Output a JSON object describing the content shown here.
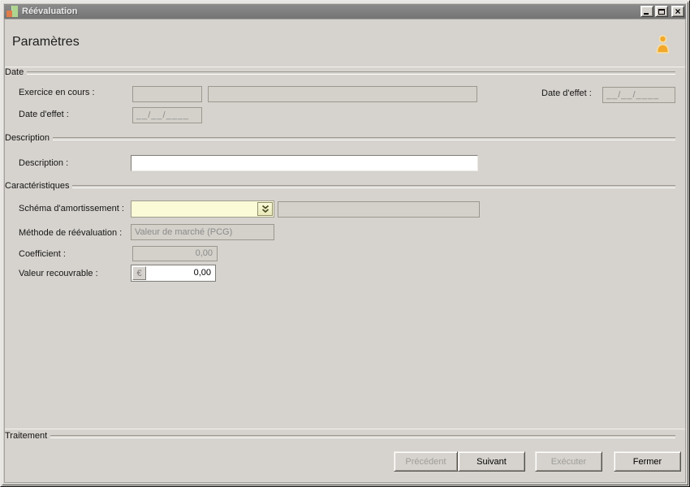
{
  "window": {
    "title": "Réévaluation",
    "controls": {
      "minimize": "minimize",
      "maximize": "maximize",
      "close": "×"
    }
  },
  "header": {
    "title": "Paramètres"
  },
  "icons": {
    "app_icon": "bar-chart",
    "user_icon": "person",
    "combo_arrow": "double-chevron-down",
    "currency_button": "€"
  },
  "sections": {
    "date": {
      "legend": "Date",
      "exercice_label": "Exercice en cours  :",
      "exercice_value1": "",
      "exercice_value2": "",
      "date_effet_right_label": "Date d'effet :",
      "date_effet_right_value": "__/__/____",
      "date_effet_label": "Date d'effet :",
      "date_effet_value": "__/__/____"
    },
    "description": {
      "legend": "Description",
      "label": "Description :",
      "value": ""
    },
    "caracteristiques": {
      "legend": "Caractéristiques",
      "schema_label": "Schéma d'amortissement :",
      "schema_value": "",
      "schema_detail_value": "",
      "methode_label": "Méthode de réévaluation :",
      "methode_value": "Valeur de marché (PCG)",
      "coefficient_label": "Coefficient :",
      "coefficient_value": "0,00",
      "valeur_label": "Valeur recouvrable :",
      "valeur_currency": "€",
      "valeur_value": "0,00"
    },
    "traitement": {
      "legend": "Traitement"
    }
  },
  "footer": {
    "buttons": [
      {
        "label": "Précédent",
        "enabled": false
      },
      {
        "label": "Suivant",
        "enabled": true
      },
      {
        "label": "Exécuter",
        "enabled": false
      },
      {
        "label": "Fermer",
        "enabled": true
      }
    ]
  },
  "colors": {
    "window_bg": "#d6d3ce",
    "titlebar": "#7f7f7f",
    "combo_bg": "#fbfbd8",
    "disabled_text": "#8b8b8b",
    "user_icon_fill": "#f2a82a",
    "app_icon_orange": "#e07c4a",
    "app_icon_green": "#aed590"
  }
}
